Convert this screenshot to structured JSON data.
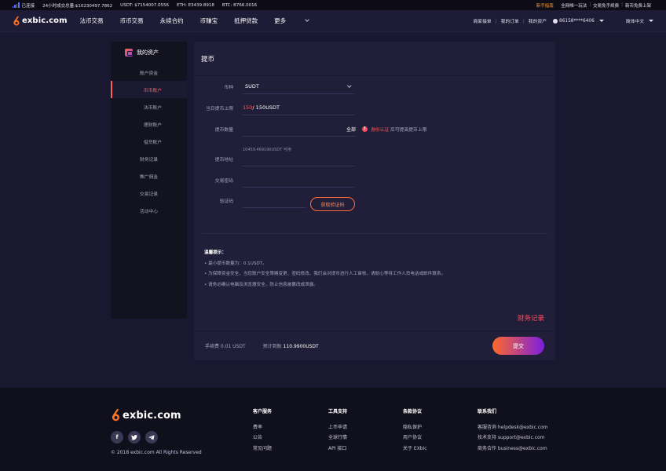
{
  "ticker": {
    "status": "已连接",
    "stats": [
      "24小时成交总量:$10230497.7862",
      "USDT: $7154007.0556",
      "ETH: E3439.8918",
      "BTC: B766.0016"
    ],
    "links": [
      "新手指南",
      "全网唯一玩法",
      "交易免手续费",
      "新币免费上架"
    ]
  },
  "nav": {
    "logo": "exbic.com",
    "menu": [
      "法币交易",
      "币币交易",
      "永续合约",
      "币赚宝",
      "抵押贷款",
      "更多"
    ],
    "right": [
      "商家接单",
      "我的订单",
      "我的资产"
    ],
    "user": "86158****6406",
    "lang": "简体中文"
  },
  "sidebar": {
    "title": "我的资产",
    "items": [
      {
        "label": "账户资金",
        "sub": false,
        "active": false
      },
      {
        "label": "币币账户",
        "sub": true,
        "active": true
      },
      {
        "label": "法币账户",
        "sub": true,
        "active": false
      },
      {
        "label": "理财账户",
        "sub": true,
        "active": false
      },
      {
        "label": "借贷账户",
        "sub": true,
        "active": false
      },
      {
        "label": "财务记录",
        "sub": false,
        "active": false
      },
      {
        "label": "推广佣金",
        "sub": false,
        "active": false
      },
      {
        "label": "交易记录",
        "sub": false,
        "active": false
      },
      {
        "label": "活动中心",
        "sub": false,
        "active": false
      }
    ]
  },
  "withdraw": {
    "title": "提币",
    "coin_label": "币种",
    "coin_value": "SUDT",
    "limit_label": "当日提币上限",
    "limit_used": "150",
    "limit_total": " / 150USDT",
    "amount_label": "提币数量",
    "amount_all": "全部",
    "verify_highlight": "身份认证",
    "verify_text": "后可提高提币上限",
    "available": "10459.469190USDT 可用",
    "address_label": "提币地址",
    "password_label": "交易密码",
    "code_label": "验证码",
    "code_button": "获取验证码",
    "tips_title": "温馨提示：",
    "tips": [
      "• 最小提币数量为：0.1USDT。",
      "• 为保障资金安全，当您账户安全策略变更、密码修改、我们会对提币进行人工审核，请耐心等待工作人员电话或邮件联系。",
      "• 请务必确认电脑及浏览器安全，防止信息被篡改或泄露。"
    ],
    "records_link": "财务记录",
    "fee": "手续费 0.01 USDT",
    "expected_label": "预计到账 ",
    "expected_value": "110.9900USDT",
    "submit": "提交"
  },
  "footer": {
    "logo": "exbic.com",
    "copyright": "© 2018 exbic.com All Rights Reserved",
    "social": [
      "f",
      "t",
      "tg"
    ],
    "columns": [
      {
        "title": "客户服务",
        "items": [
          "费率",
          "公告",
          "常见问题"
        ]
      },
      {
        "title": "工具支持",
        "items": [
          "上币申请",
          "全球行情",
          "API 接口"
        ]
      },
      {
        "title": "条款协议",
        "items": [
          "隐私保护",
          "用户协议",
          "关于 EXbic"
        ]
      },
      {
        "title": "联系我们",
        "items": [
          "客服咨询 helpdesk@exbic.com",
          "技术支持 support@exbic.com",
          "商务合作 business@exbic.com"
        ]
      }
    ]
  },
  "colors": {
    "accent": "#ff5c5c",
    "gradient_start": "#ff6a2a",
    "gradient_end": "#7b1ee0",
    "panel": "#201e38"
  }
}
